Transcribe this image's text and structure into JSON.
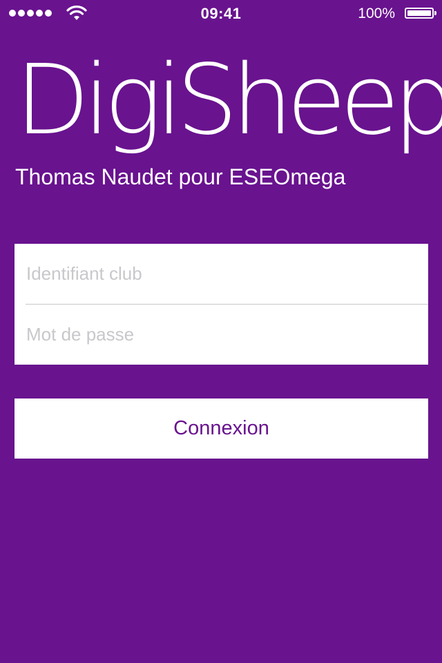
{
  "status_bar": {
    "time": "09:41",
    "battery_percent": "100%",
    "signal_icon": "signal-dots-icon",
    "wifi_icon": "wifi-icon",
    "battery_icon": "battery-icon"
  },
  "header": {
    "app_title": "DigiSheep",
    "subtitle": "Thomas Naudet pour ESEOmega"
  },
  "login_form": {
    "login_placeholder": "Identifiant club",
    "login_value": "",
    "password_placeholder": "Mot de passe",
    "password_value": ""
  },
  "actions": {
    "connect_label": "Connexion"
  },
  "colors": {
    "background": "#69138f",
    "accent": "#69138f",
    "field_background": "#ffffff",
    "placeholder": "#c8c8cc"
  }
}
